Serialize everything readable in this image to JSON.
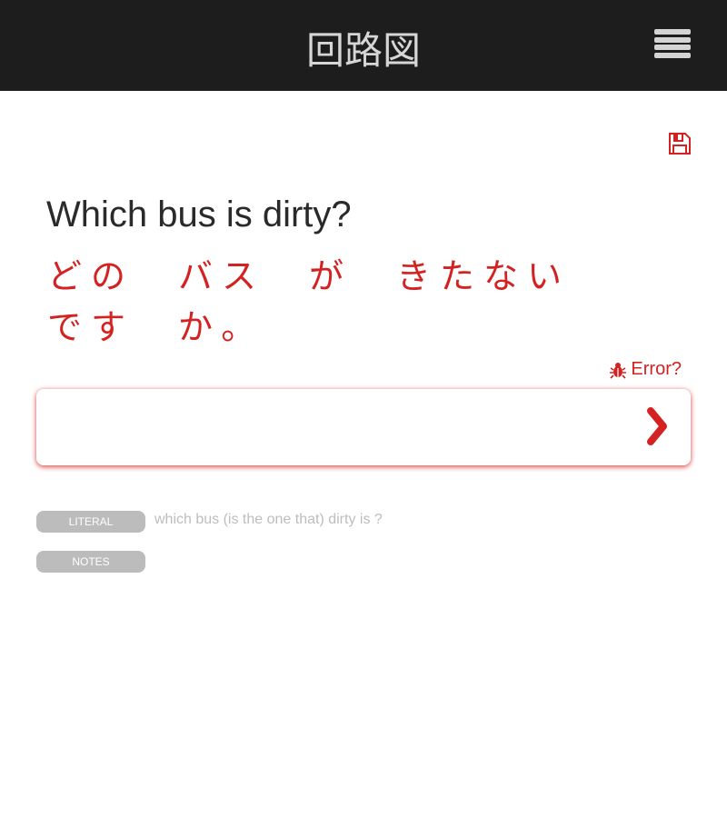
{
  "header": {
    "title": "回路図",
    "menu_icon": "hamburger-menu-icon"
  },
  "toolbar": {
    "save_icon": "floppy-disk-icon"
  },
  "question": {
    "english": "Which bus is dirty?",
    "japanese_lines": [
      [
        "どの",
        "バス",
        "が",
        "きたない"
      ],
      [
        "です",
        "か。"
      ]
    ]
  },
  "error_link": {
    "label": "Error?",
    "icon": "bug-icon"
  },
  "answer": {
    "value": "",
    "placeholder": "",
    "submit_icon": "chevron-right-icon"
  },
  "literal": {
    "label": "LITERAL",
    "text": "which bus (is the one that) dirty is ?"
  },
  "notes": {
    "label": "NOTES"
  },
  "colors": {
    "accent": "#d42222",
    "header_bg": "#1d1d1d",
    "tag_bg": "#bcbcbc"
  }
}
